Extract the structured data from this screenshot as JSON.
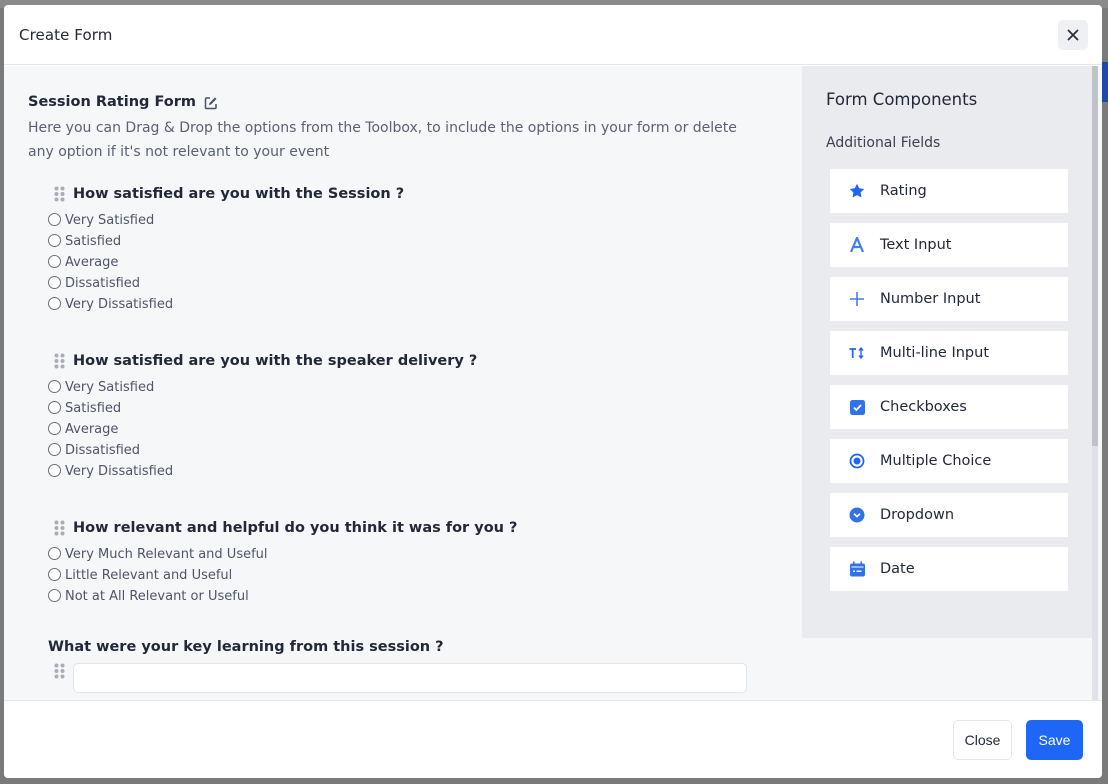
{
  "modal": {
    "title": "Create Form",
    "close_icon": "close-icon"
  },
  "form": {
    "title": "Session Rating Form",
    "edit_icon": "edit-icon",
    "description": "Here you can Drag & Drop the options from the Toolbox, to include the options in your form or delete any option if it's not relevant to your event",
    "questions": [
      {
        "label": "How satisfied are you with the Session ?",
        "type": "radio",
        "options": [
          "Very Satisfied",
          "Satisfied",
          "Average",
          "Dissatisfied",
          "Very Dissatisfied"
        ]
      },
      {
        "label": "How satisfied are you with the speaker delivery ?",
        "type": "radio",
        "options": [
          "Very Satisfied",
          "Satisfied",
          "Average",
          "Dissatisfied",
          "Very Dissatisfied"
        ]
      },
      {
        "label": "How relevant and helpful do you think it was for you ?",
        "type": "radio",
        "options": [
          "Very Much Relevant and Useful",
          "Little Relevant and Useful",
          "Not at All Relevant or Useful"
        ]
      },
      {
        "label": "What were your key learning from this session ?",
        "type": "text",
        "value": ""
      }
    ]
  },
  "sidebar": {
    "title": "Form Components",
    "subtitle": "Additional Fields",
    "accent": "#1e66f5",
    "components": [
      {
        "label": "Rating",
        "icon": "star-icon"
      },
      {
        "label": "Text Input",
        "icon": "text-a-icon"
      },
      {
        "label": "Number Input",
        "icon": "plus-icon"
      },
      {
        "label": "Multi-line Input",
        "icon": "text-height-icon"
      },
      {
        "label": "Checkboxes",
        "icon": "checkbox-icon"
      },
      {
        "label": "Multiple Choice",
        "icon": "radio-dot-icon"
      },
      {
        "label": "Dropdown",
        "icon": "chevron-circle-icon"
      },
      {
        "label": "Date",
        "icon": "calendar-icon"
      }
    ]
  },
  "footer": {
    "close_label": "Close",
    "save_label": "Save"
  }
}
